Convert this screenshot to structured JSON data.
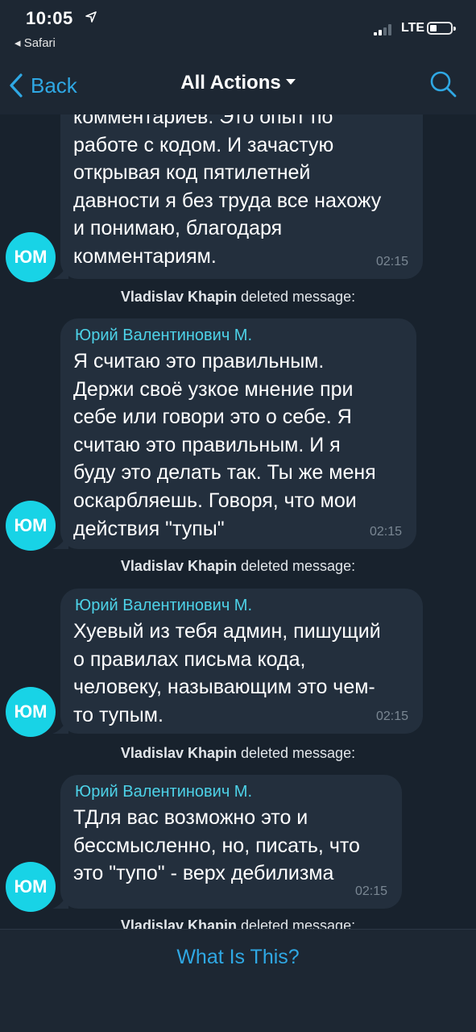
{
  "status_bar": {
    "time": "10:05",
    "back_app": "◂ Safari",
    "network": "LTE"
  },
  "nav": {
    "back_label": "Back",
    "title": "All Actions"
  },
  "messages": [
    {
      "sender": "",
      "text": "комментариев. Это опыт по\nработе с кодом. И зачастую\nоткрывая код пятилетней\nдавности я без труда все нахожу\nи понимаю, благодаря\nкомментариям.",
      "time": "02:15",
      "avatar": "ЮМ"
    },
    {
      "sender": "Юрий Валентинович М.",
      "text": "Я считаю это правильным.\nДержи своё узкое мнение при\nсебе или говори это о себе. Я\nсчитаю это правильным. И я\nбуду это делать так. Ты же меня\nоскарбляешь. Говоря, что мои\nдействия \"тупы\"",
      "time": "02:15",
      "avatar": "ЮМ"
    },
    {
      "sender": "Юрий Валентинович М.",
      "text": "Хуевый из тебя админ, пишущий\nо правилах письма кода,\nчеловеку, называющим это чем-\nто тупым.",
      "time": "02:15",
      "avatar": "ЮМ"
    },
    {
      "sender": "Юрий Валентинович М.",
      "text": "ТДля вас возможно это и\nбессмысленно, но, писать, что\nэто \"тупо\" - верх дебилизма",
      "time": "02:15",
      "avatar": "ЮМ"
    }
  ],
  "deleted_notice": {
    "actor": "Vladislav Khapin",
    "action": "deleted message:"
  },
  "bottom": {
    "button_label": "What Is This?"
  },
  "colors": {
    "background": "#18222d",
    "bar": "#1d2733",
    "bubble": "#232f3d",
    "accent": "#2fa8e4",
    "sender": "#4dd2e8",
    "avatar": "#18d3e6"
  }
}
